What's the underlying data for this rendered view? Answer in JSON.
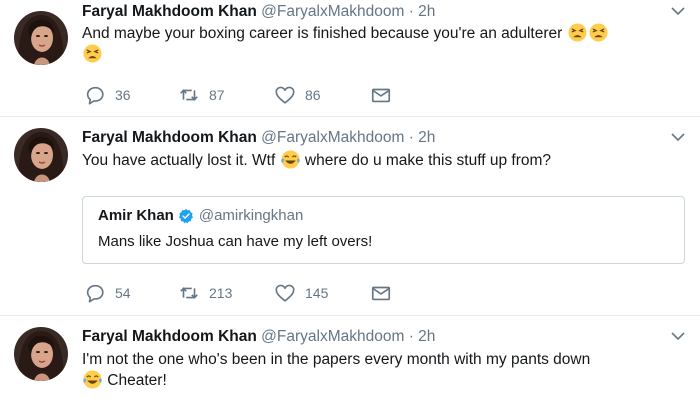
{
  "tweets": [
    {
      "name": "Faryal Makhdoom Khan",
      "handle": "@FaryalxMakhdoom",
      "time": "· 2h",
      "text_before": "And maybe your boxing career is finished because you're an adulterer ",
      "text_after": "",
      "emojis": [
        "tired-face-emoji",
        "tired-face-emoji",
        "tired-face-emoji"
      ],
      "replies": "36",
      "retweets": "87",
      "likes": "86"
    },
    {
      "name": "Faryal Makhdoom Khan",
      "handle": "@FaryalxMakhdoom",
      "time": "· 2h",
      "text_before": "You have actually lost it. Wtf ",
      "text_after": " where do u make this stuff up from?",
      "emojis": [
        "tears-of-joy-emoji"
      ],
      "quote": {
        "name": "Amir Khan",
        "handle": "@amirkingkhan",
        "text": "Mans like Joshua can have my left overs!"
      },
      "replies": "54",
      "retweets": "213",
      "likes": "145"
    },
    {
      "name": "Faryal Makhdoom Khan",
      "handle": "@FaryalxMakhdoom",
      "time": "· 2h",
      "text_before": "I'm not the one who's been in the papers every month with my pants down",
      "text_after": " Cheater!",
      "emojis": [
        "tears-of-joy-emoji"
      ]
    }
  ],
  "colors": {
    "text": "#14171a",
    "secondary": "#657786",
    "divider": "#e6ecf0",
    "verified": "#1da1f2",
    "emoji_yellow": "#ffcc4d",
    "tears": "#5dadec"
  },
  "icons": [
    "reply-icon",
    "retweet-icon",
    "like-icon",
    "dm-icon",
    "caret-down-icon",
    "verified-badge-icon"
  ]
}
